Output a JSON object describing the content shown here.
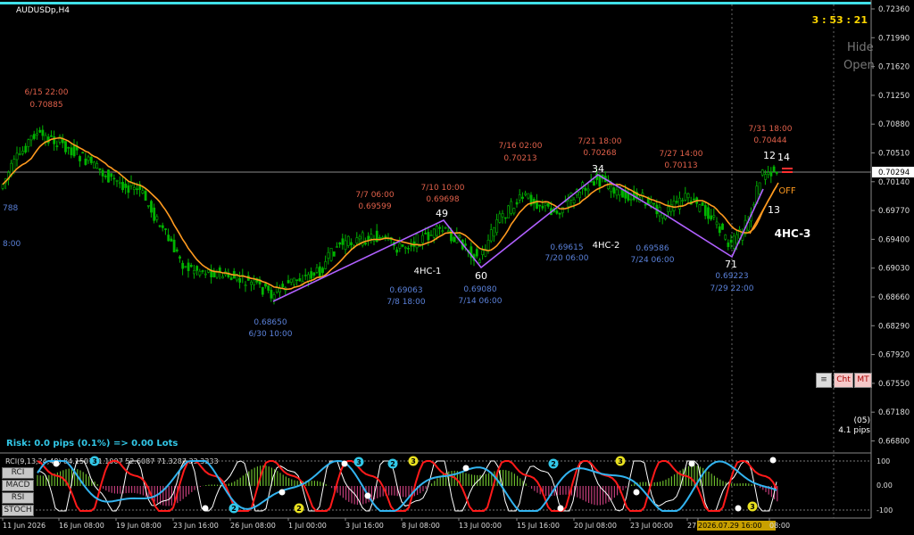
{
  "window": {
    "title": "AUDUSDp,H4"
  },
  "timer": "3 : 53 : 21",
  "side_labels": {
    "hide": "Hide",
    "open": "Open"
  },
  "current_price": "0.70294",
  "price_axis": [
    "0.72360",
    "0.71990",
    "0.71620",
    "0.71250",
    "0.70880",
    "0.70510",
    "0.70140",
    "0.69770",
    "0.69400",
    "0.69030",
    "0.68660",
    "0.68290",
    "0.67920",
    "0.67550",
    "0.67180",
    "0.66800"
  ],
  "indicator_axis": [
    "100",
    "0.00",
    "-100"
  ],
  "left_partial": [
    "788",
    "8:00"
  ],
  "zigzag": {
    "highs": [
      {
        "date": "6/15 22:00",
        "price": "0.70885"
      },
      {
        "date": "7/7 06:00",
        "price": "0.69599"
      },
      {
        "date": "7/10 10:00",
        "price": "0.69698"
      },
      {
        "date": "7/16 02:00",
        "price": "0.70213"
      },
      {
        "date": "7/21 18:00",
        "price": "0.70268"
      },
      {
        "date": "7/27 14:00",
        "price": "0.70113"
      },
      {
        "date": "7/31 18:00",
        "price": "0.70444"
      }
    ],
    "lows": [
      {
        "price": "0.68650",
        "date": "6/30 10:00"
      },
      {
        "price": "0.69063",
        "date": "7/8 18:00"
      },
      {
        "price": "0.69080",
        "date": "7/14 06:00"
      },
      {
        "price": "0.69615",
        "date": "7/20 06:00"
      },
      {
        "price": "0.69586",
        "date": "7/24 06:00"
      },
      {
        "price": "0.69223",
        "date": "7/29 22:00"
      }
    ],
    "counts": [
      "49",
      "60",
      "34",
      "71",
      "12",
      "14",
      "13"
    ],
    "patterns": [
      "4HC-1",
      "4HC-2",
      "4HC-3"
    ]
  },
  "off_label": "OFF",
  "pips_label": {
    "count": "(05)",
    "pips": "4.1 pips"
  },
  "risk_text": "Risk: 0.0 pips (0.1%) => 0.00 Lots",
  "mini_buttons": [
    "Cht",
    "MT"
  ],
  "indicator_header": "RCI(9,13,24,48) 84.1507 -1.1907 52.6087 71.3287 33.3333",
  "indicator_buttons": [
    "RCI",
    "MACD",
    "RSI",
    "STOCH"
  ],
  "badge_numbers": [
    "3",
    "2",
    "2",
    "3",
    "2",
    "3",
    "2",
    "3",
    "3"
  ],
  "time_axis": [
    "11 Jun 2026",
    "16 Jun 08:00",
    "19 Jun 08:00",
    "23 Jun 16:00",
    "26 Jun 08:00",
    "1 Jul 00:00",
    "3 Jul 16:00",
    "8 Jul 08:00",
    "13 Jul 00:00",
    "15 Jul 16:00",
    "20 Jul 08:00",
    "23 Jul 00:00",
    "27",
    "2026.07.29 16:00",
    "08:00"
  ],
  "colors": {
    "bull": "#00b400",
    "ma": "#ff9a1f",
    "zigzag": "#b060ff",
    "high_label": "#e0604a",
    "low_label": "#5a80d8",
    "cyan": "#32c8e8",
    "red": "#ff1a1a",
    "timer": "#ffd700"
  }
}
